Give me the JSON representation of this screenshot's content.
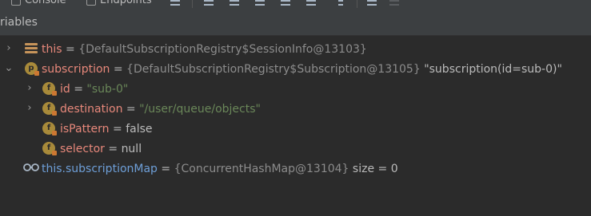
{
  "toolbar": {
    "tabs": [
      {
        "label": "Console",
        "icon": "console-icon"
      },
      {
        "label": "Endpoints",
        "icon": "endpoints-icon"
      }
    ]
  },
  "panel": {
    "title": "riables"
  },
  "variables": [
    {
      "name": "this",
      "eq": "=",
      "value": "{DefaultSubscriptionRegistry$SessionInfo@13103}",
      "expandable": true,
      "expanded": false,
      "icon": "object-stack-icon"
    },
    {
      "name": "subscription",
      "eq": "=",
      "value": "{DefaultSubscriptionRegistry$Subscription@13105}",
      "extra": "\"subscription(id=sub-0)\"",
      "expandable": true,
      "expanded": true,
      "icon": "parameter-icon",
      "icon_letter": "p"
    },
    {
      "name": "id",
      "eq": "=",
      "value": "\"sub-0\"",
      "expandable": true,
      "expanded": false,
      "icon": "field-icon",
      "icon_letter": "f"
    },
    {
      "name": "destination",
      "eq": "=",
      "value": "\"/user/queue/objects\"",
      "expandable": true,
      "expanded": false,
      "icon": "field-icon",
      "icon_letter": "f"
    },
    {
      "name": "isPattern",
      "eq": "=",
      "value": "false",
      "expandable": false,
      "icon": "field-icon",
      "icon_letter": "f"
    },
    {
      "name": "selector",
      "eq": "=",
      "value": "null",
      "expandable": false,
      "icon": "field-icon",
      "icon_letter": "f"
    },
    {
      "name": "this.subscriptionMap",
      "eq": "=",
      "value": "{ConcurrentHashMap@13104}",
      "extra": "size = 0",
      "expandable": false,
      "icon": "watch-glasses-icon"
    }
  ],
  "colors": {
    "background": "#2b2b2b",
    "header": "#3c3f41",
    "name": "#e8887b",
    "watch_name": "#6e9fd8",
    "string": "#6a8759",
    "type": "#8c8c8c",
    "text": "#bbbbbb"
  }
}
